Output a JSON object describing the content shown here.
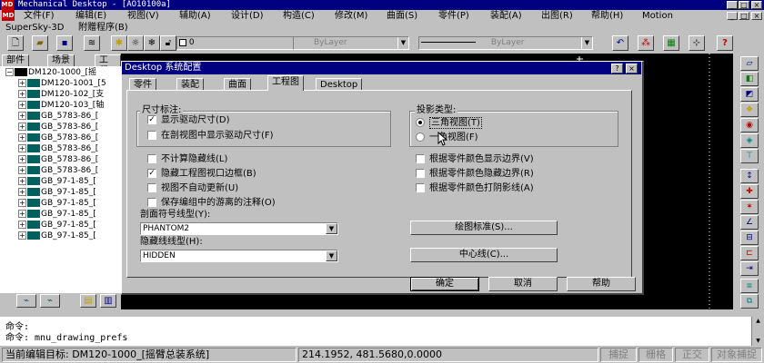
{
  "window": {
    "title": "Mechanical Desktop - [AO10100a]",
    "icon_text": "MD"
  },
  "menubar": {
    "items": [
      "文件(F)",
      "编辑(E)",
      "视图(V)",
      "辅助(A)",
      "设计(D)",
      "构造(C)",
      "修改(M)",
      "曲面(S)",
      "零件(P)",
      "装配(A)",
      "出图(R)",
      "帮助(H)",
      "Motion"
    ],
    "items2": [
      "SuperSky-3D",
      "附赠程序(B)"
    ]
  },
  "toolbar": {
    "layer_value": "0",
    "linetype_combo": "ByLayer",
    "lineweight_combo": "ByLayer"
  },
  "left_panel": {
    "tabs": [
      "部件",
      "场景",
      "工程图"
    ],
    "tree": [
      {
        "label": "DM120-1000_[摇",
        "prefix": "⊟",
        "icon": "black"
      },
      {
        "label": "DM120-1001_[5",
        "prefix": "⊞",
        "icon": "teal"
      },
      {
        "label": "DM120-102_[支",
        "prefix": "⊞",
        "icon": "teal"
      },
      {
        "label": "DM120-103_[轴",
        "prefix": "⊞",
        "icon": "teal"
      },
      {
        "label": "GB_5783-86_[",
        "prefix": "⊞",
        "icon": "teal"
      },
      {
        "label": "GB_5783-86_[",
        "prefix": "⊞",
        "icon": "teal"
      },
      {
        "label": "GB_5783-86_[",
        "prefix": "⊞",
        "icon": "teal"
      },
      {
        "label": "GB_5783-86_[",
        "prefix": "⊞",
        "icon": "teal"
      },
      {
        "label": "GB_5783-86_[",
        "prefix": "⊞",
        "icon": "teal"
      },
      {
        "label": "GB_5783-86_[",
        "prefix": "⊞",
        "icon": "teal"
      },
      {
        "label": "GB_97-1-85_[",
        "prefix": "⊞",
        "icon": "teal"
      },
      {
        "label": "GB_97-1-85_[",
        "prefix": "⊞",
        "icon": "teal"
      },
      {
        "label": "GB_97-1-85_[",
        "prefix": "⊞",
        "icon": "teal"
      },
      {
        "label": "GB_97-1-85_[",
        "prefix": "⊞",
        "icon": "teal"
      },
      {
        "label": "GB_97-1-85_[",
        "prefix": "⊞",
        "icon": "teal"
      },
      {
        "label": "GB_97-1-85_[",
        "prefix": "⊞",
        "icon": "teal"
      }
    ]
  },
  "dialog": {
    "title": "Desktop 系统配置",
    "help_btn": "?",
    "close_btn": "×",
    "tabs": [
      "零件",
      "装配",
      "曲面",
      "工程图",
      "Desktop"
    ],
    "active_tab": "工程图",
    "dimension_group": {
      "label": "尺寸标注:",
      "show_driving": {
        "label": "显示驱动尺寸(D)",
        "checked": true
      },
      "show_in_section": {
        "label": "在剖视图中显示驱动尺寸(F)",
        "checked": false
      }
    },
    "projection_group": {
      "label": "投影类型:",
      "third_angle": {
        "label": "三角视图(T)",
        "selected": true
      },
      "first_angle": {
        "label": "一角视图(F)",
        "selected": false
      }
    },
    "options_left": [
      {
        "label": "不计算隐藏线(L)",
        "checked": false
      },
      {
        "label": "隐藏工程图视口边框(B)",
        "checked": true
      },
      {
        "label": "视图不自动更新(U)",
        "checked": false
      },
      {
        "label": "保存编组中的游离的注释(O)",
        "checked": false
      }
    ],
    "options_right": [
      {
        "label": "根据零件颜色显示边界(V)",
        "checked": false
      },
      {
        "label": "根据零件颜色隐藏边界(R)",
        "checked": false
      },
      {
        "label": "根据零件颜色打阴影线(A)",
        "checked": false
      }
    ],
    "section_linetype": {
      "label": "剖面符号线型(Y):",
      "value": "PHANTOM2"
    },
    "hidden_linetype": {
      "label": "隐藏线线型(H):",
      "value": "HIDDEN"
    },
    "drawing_standards_btn": "绘图标准(S)...",
    "centerline_btn": "中心线(C)...",
    "ok_btn": "确定",
    "cancel_btn": "取消",
    "help_text_btn": "帮助"
  },
  "command": {
    "line1": "命令:",
    "line2": "命令: mnu_drawing_prefs"
  },
  "status": {
    "target": "当前编辑目标: DM120-1000_[摇臂总装系统]",
    "coords": "214.1952, 481.5680,0.0000",
    "snap": "捕捉",
    "grid": "栅格",
    "ortho": "正交",
    "osnap": "对象捕捉"
  },
  "colors": {
    "titlebar": "#000080",
    "face": "#c0c0c0",
    "canvas": "#000000"
  }
}
